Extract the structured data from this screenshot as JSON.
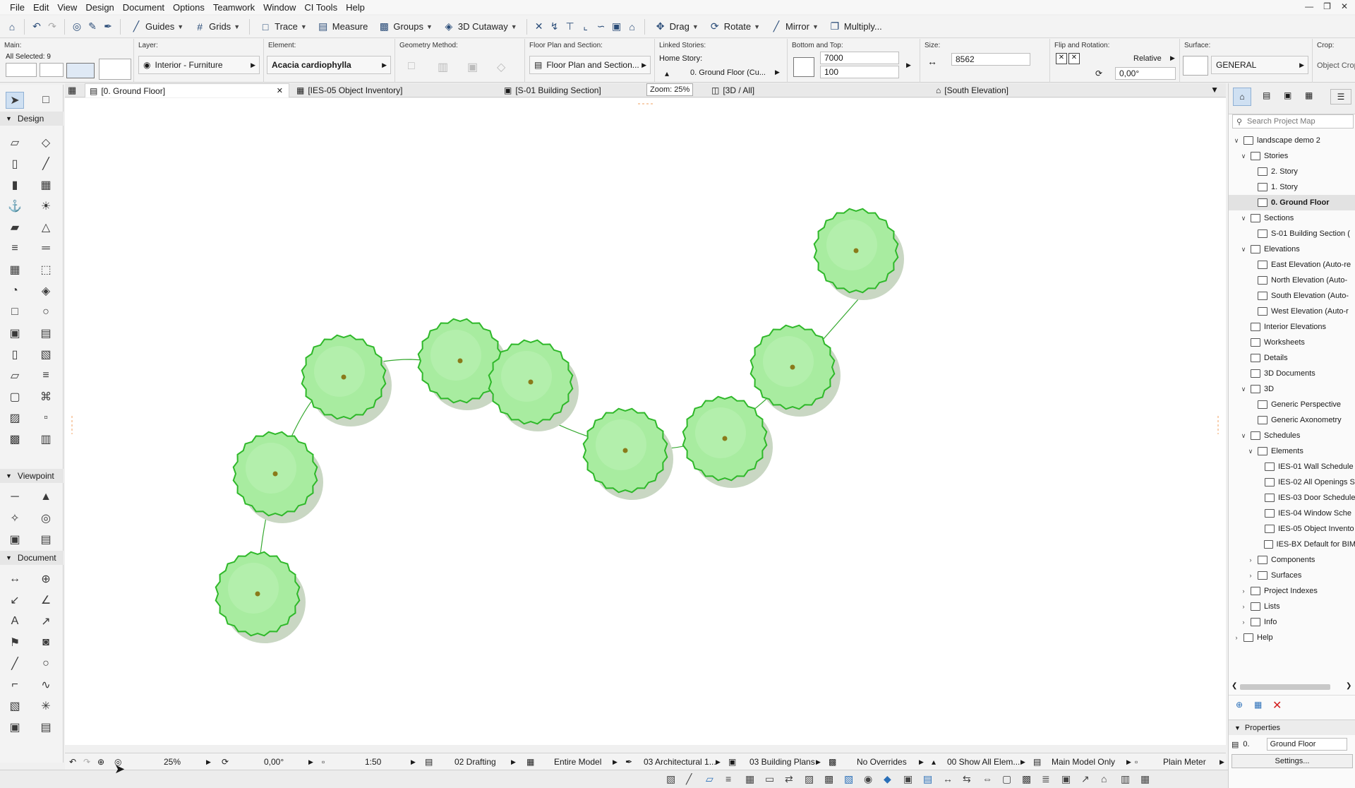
{
  "menu": [
    "File",
    "Edit",
    "View",
    "Design",
    "Document",
    "Options",
    "Teamwork",
    "Window",
    "CI Tools",
    "Help"
  ],
  "toolbar": {
    "guides": "Guides",
    "grids": "Grids",
    "trace": "Trace",
    "measure": "Measure",
    "groups": "Groups",
    "cutaway": "3D Cutaway",
    "drag": "Drag",
    "rotate": "Rotate",
    "mirror": "Mirror",
    "multiply": "Multiply..."
  },
  "infobox": {
    "main_label": "Main:",
    "all_selected": "All Selected: 9",
    "layer_label": "Layer:",
    "layer_value": "Interior - Furniture",
    "element_label": "Element:",
    "element_value": "Acacia cardiophylla",
    "geometry_label": "Geometry Method:",
    "floorplan_label": "Floor Plan and Section:",
    "floorplan_value": "Floor Plan and Section...",
    "linked_label": "Linked Stories:",
    "home_story_label": "Home Story:",
    "home_story_value": "0. Ground Floor (Cu...",
    "bottomtop_label": "Bottom and Top:",
    "top_value": "7000",
    "bottom_value": "100",
    "size_label": "Size:",
    "size_value": "8562",
    "flip_label": "Flip and Rotation:",
    "relative": "Relative",
    "rotation_value": "0,00°",
    "surface_label": "Surface:",
    "surface_value": "GENERAL",
    "crop_label": "Crop:",
    "crop_value": "Object Crop"
  },
  "tabs": [
    {
      "label": "[0. Ground Floor]",
      "icon": "floorplan-icon"
    },
    {
      "label": "[IES-05 Object Inventory]",
      "icon": "schedule-icon"
    },
    {
      "label": "[S-01 Building Section]",
      "icon": "section-icon"
    },
    {
      "label": "[3D / All]",
      "icon": "3d-icon"
    },
    {
      "label": "[South Elevation]",
      "icon": "elevation-icon"
    }
  ],
  "zoom_tooltip": "Zoom: 25%",
  "toolbox": {
    "design": "Design",
    "viewpoint": "Viewpoint",
    "document": "Document"
  },
  "status": {
    "zoom": "25%",
    "angle": "0,00°",
    "scale": "1:50",
    "layer_combo": "02 Drafting",
    "model": "Entire Model",
    "pen_set": "03 Architectural 1...",
    "mvo": "03 Building Plans",
    "override": "No Overrides",
    "renovation": "00 Show All Elem...",
    "structure": "Main Model Only",
    "dimension": "Plain Meter"
  },
  "navigator": {
    "search_placeholder": "Search Project Map",
    "tree": [
      {
        "label": "landscape demo 2",
        "level": 0,
        "tw": "v"
      },
      {
        "label": "Stories",
        "level": 1,
        "tw": "v"
      },
      {
        "label": "2. Story",
        "level": 2,
        "tw": ""
      },
      {
        "label": "1. Story",
        "level": 2,
        "tw": ""
      },
      {
        "label": "0. Ground Floor",
        "level": 2,
        "tw": "",
        "selected": true
      },
      {
        "label": "Sections",
        "level": 1,
        "tw": "v"
      },
      {
        "label": "S-01 Building Section (",
        "level": 2,
        "tw": ""
      },
      {
        "label": "Elevations",
        "level": 1,
        "tw": "v"
      },
      {
        "label": "East Elevation (Auto-re",
        "level": 2,
        "tw": ""
      },
      {
        "label": "North Elevation (Auto-",
        "level": 2,
        "tw": ""
      },
      {
        "label": "South Elevation (Auto-",
        "level": 2,
        "tw": ""
      },
      {
        "label": "West Elevation (Auto-r",
        "level": 2,
        "tw": ""
      },
      {
        "label": "Interior Elevations",
        "level": 1,
        "tw": ""
      },
      {
        "label": "Worksheets",
        "level": 1,
        "tw": ""
      },
      {
        "label": "Details",
        "level": 1,
        "tw": ""
      },
      {
        "label": "3D Documents",
        "level": 1,
        "tw": ""
      },
      {
        "label": "3D",
        "level": 1,
        "tw": "v"
      },
      {
        "label": "Generic Perspective",
        "level": 2,
        "tw": ""
      },
      {
        "label": "Generic Axonometry",
        "level": 2,
        "tw": ""
      },
      {
        "label": "Schedules",
        "level": 1,
        "tw": "v"
      },
      {
        "label": "Elements",
        "level": 2,
        "tw": "v"
      },
      {
        "label": "IES-01 Wall Schedule",
        "level": 3,
        "tw": ""
      },
      {
        "label": "IES-02 All Openings S",
        "level": 3,
        "tw": ""
      },
      {
        "label": "IES-03 Door Schedule",
        "level": 3,
        "tw": ""
      },
      {
        "label": "IES-04 Window Sche",
        "level": 3,
        "tw": ""
      },
      {
        "label": "IES-05 Object Invento",
        "level": 3,
        "tw": ""
      },
      {
        "label": "IES-BX Default for BIM",
        "level": 3,
        "tw": ""
      },
      {
        "label": "Components",
        "level": 2,
        "tw": ">"
      },
      {
        "label": "Surfaces",
        "level": 2,
        "tw": ">"
      },
      {
        "label": "Project Indexes",
        "level": 1,
        "tw": ">"
      },
      {
        "label": "Lists",
        "level": 1,
        "tw": ">"
      },
      {
        "label": "Info",
        "level": 1,
        "tw": ">"
      },
      {
        "label": "Help",
        "level": 0,
        "tw": ">"
      }
    ],
    "properties_label": "Properties",
    "prop_id": "0.",
    "prop_name": "Ground Floor",
    "settings_btn": "Settings..."
  },
  "colors": {
    "tree_fill": "#a8eca0",
    "tree_stroke": "#2fb82a",
    "shadow": "#c9d7c3",
    "center_dot": "#8a7a1a"
  }
}
